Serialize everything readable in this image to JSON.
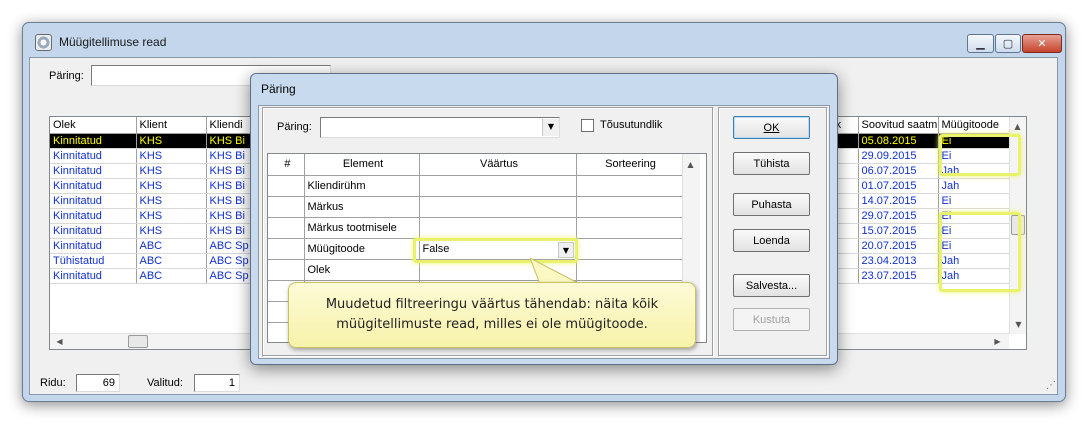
{
  "window": {
    "title": "Müügitellimuse read",
    "query_label": "Päring:",
    "query_value": ""
  },
  "grid": {
    "columns_left": [
      "Olek",
      "Klient",
      "Kliendi"
    ],
    "columns_right": [
      "ühik",
      "Soovitud saatm",
      "Müügitoode"
    ],
    "rows": [
      {
        "olek": "Kinnitatud",
        "klient": "KHS",
        "kliendi": "KHS Bi",
        "soovitud": "05.08.2015",
        "muugitoode": "Ei"
      },
      {
        "olek": "Kinnitatud",
        "klient": "KHS",
        "kliendi": "KHS Bi",
        "soovitud": "29.09.2015",
        "muugitoode": "Ei"
      },
      {
        "olek": "Kinnitatud",
        "klient": "KHS",
        "kliendi": "KHS Bi",
        "soovitud": "06.07.2015",
        "muugitoode": "Jah"
      },
      {
        "olek": "Kinnitatud",
        "klient": "KHS",
        "kliendi": "KHS Bi",
        "soovitud": "01.07.2015",
        "muugitoode": "Jah"
      },
      {
        "olek": "Kinnitatud",
        "klient": "KHS",
        "kliendi": "KHS Bi",
        "soovitud": "14.07.2015",
        "muugitoode": "Ei"
      },
      {
        "olek": "Kinnitatud",
        "klient": "KHS",
        "kliendi": "KHS Bi",
        "soovitud": "29.07.2015",
        "muugitoode": "Ei"
      },
      {
        "olek": "Kinnitatud",
        "klient": "KHS",
        "kliendi": "KHS Bi",
        "soovitud": "15.07.2015",
        "muugitoode": "Ei"
      },
      {
        "olek": "Kinnitatud",
        "klient": "ABC",
        "kliendi": "ABC Sp",
        "soovitud": "20.07.2015",
        "muugitoode": "Ei"
      },
      {
        "olek": "Tühistatud",
        "klient": "ABC",
        "kliendi": "ABC Sp",
        "soovitud": "23.04.2013",
        "muugitoode": "Jah"
      },
      {
        "olek": "Kinnitatud",
        "klient": "ABC",
        "kliendi": "ABC Sp",
        "soovitud": "23.07.2015",
        "muugitoode": "Jah"
      }
    ]
  },
  "status": {
    "ridu_label": "Ridu:",
    "ridu_value": "69",
    "valitud_label": "Valitud:",
    "valitud_value": "1"
  },
  "dialog": {
    "title": "Päring",
    "query_label": "Päring:",
    "query_value": "",
    "ascending_label": "Tõusutundlik",
    "columns": [
      "#",
      "Element",
      "Väärtus",
      "Sorteering"
    ],
    "rows": [
      {
        "element": "Kliendirühm",
        "value": "",
        "sort": ""
      },
      {
        "element": "Märkus",
        "value": "",
        "sort": ""
      },
      {
        "element": "Märkus tootmisele",
        "value": "",
        "sort": ""
      },
      {
        "element": "Müügitoode",
        "value": "False",
        "sort": ""
      },
      {
        "element": "Olek",
        "value": "",
        "sort": ""
      }
    ],
    "buttons": {
      "ok": "OK",
      "cancel": "Tühista",
      "clear": "Puhasta",
      "load": "Loenda",
      "save": "Salvesta...",
      "delete": "Kustuta"
    }
  },
  "callout": {
    "text": "Muudetud filtreeringu väärtus tähendab: näita kõik müügitellimuste read, milles ei ole müügitoode."
  },
  "colors": {
    "highlight": "#e8f26a",
    "selected_row_bg": "#000000",
    "selected_row_text": "#ffff00",
    "row_text": "#1030d0"
  }
}
